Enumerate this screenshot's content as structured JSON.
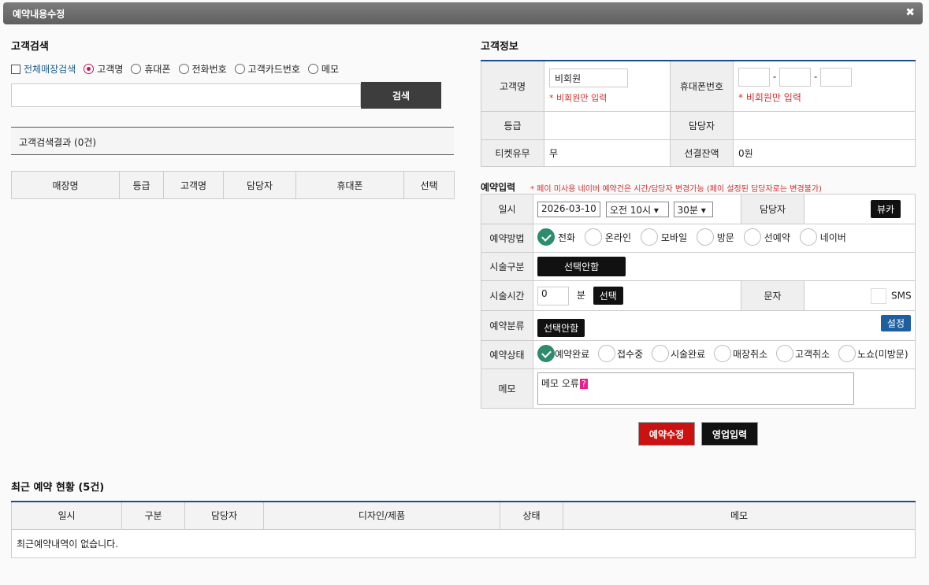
{
  "window": {
    "title": "예약내용수정",
    "close_symbol": "✖"
  },
  "customer_search": {
    "heading": "고객검색",
    "options": [
      {
        "label": "전체매장검색",
        "kind": "checkbox",
        "checked": false
      },
      {
        "label": "고객명",
        "kind": "radio",
        "checked": true
      },
      {
        "label": "휴대폰",
        "kind": "radio",
        "checked": false
      },
      {
        "label": "전화번호",
        "kind": "radio",
        "checked": false
      },
      {
        "label": "고객카드번호",
        "kind": "radio",
        "checked": false
      },
      {
        "label": "메모",
        "kind": "radio",
        "checked": false
      }
    ],
    "search_value": "",
    "search_button": "검색",
    "result_label": "고객검색결과 (0건)",
    "columns": [
      "매장명",
      "등급",
      "고객명",
      "담당자",
      "휴대폰",
      "선택"
    ]
  },
  "customer_info": {
    "heading": "고객정보",
    "name_label": "고객명",
    "name_value": "비회원",
    "name_note": "* 비회원만 입력",
    "phone_label": "휴대폰번호",
    "phone_sep": "-",
    "phone_note": "* 비회원만 입력",
    "grade_label": "등급",
    "grade_value": "",
    "staff_label": "담당자",
    "staff_value": "",
    "ticket_label": "티켓유무",
    "ticket_value": "무",
    "prepaid_label": "선결잔액",
    "prepaid_value": "0원"
  },
  "reservation": {
    "heading": "예약입력",
    "note": "* 페이 미사용 네이버 예약건은 시간/담당자 변경가능 (페이 설정된 담당자로는 변경불가)",
    "date_label": "일시",
    "date_value": "2026-03-10",
    "hour_value": "오전 10시",
    "minute_value": "30분",
    "staff_label": "담당자",
    "staff_value": "뷰카",
    "method_label": "예약방법",
    "methods": [
      {
        "label": "전화",
        "checked": true
      },
      {
        "label": "온라인",
        "checked": false
      },
      {
        "label": "모바일",
        "checked": false
      },
      {
        "label": "방문",
        "checked": false
      },
      {
        "label": "선예약",
        "checked": false
      },
      {
        "label": "네이버",
        "checked": false
      }
    ],
    "treatment_label": "시술구분",
    "treatment_value": "선택안함",
    "duration_label": "시술시간",
    "duration_value": "0",
    "duration_unit": "분",
    "duration_button": "선택",
    "sms_section_label": "문자",
    "sms_label": "SMS",
    "category_label": "예약분류",
    "category_value": "선택안함",
    "settings_button": "설정",
    "status_label": "예약상태",
    "statuses": [
      {
        "label": "예약완료",
        "checked": true
      },
      {
        "label": "접수중",
        "checked": false
      },
      {
        "label": "시술완료",
        "checked": false
      },
      {
        "label": "매장취소",
        "checked": false
      },
      {
        "label": "고객취소",
        "checked": false
      },
      {
        "label": "노쇼(미방문)",
        "checked": false
      }
    ],
    "memo_label": "메모",
    "memo_value": "메모 오류",
    "memo_mark": "?"
  },
  "actions": {
    "edit_button": "예약수정",
    "sales_button": "영업입력"
  },
  "recent": {
    "heading": "최근 예약 현황 (5건)",
    "columns": [
      "일시",
      "구분",
      "담당자",
      "디자인/제품",
      "상태",
      "메모"
    ],
    "empty_message": "최근예약내역이 없습니다."
  }
}
